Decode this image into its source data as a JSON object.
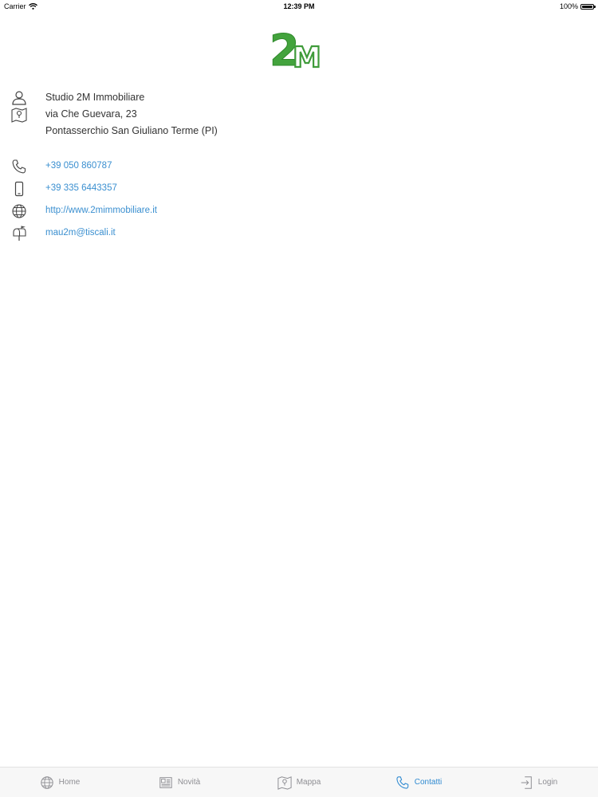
{
  "status": {
    "carrier": "Carrier",
    "time": "12:39 PM",
    "battery": "100%",
    "battery_level": 1.0
  },
  "logo": {
    "text": "2M",
    "color_primary": "#3f9b3a",
    "color_outline": "#2f8a2b"
  },
  "contact": {
    "name": "Studio 2M Immobiliare",
    "address_line1": "via Che Guevara, 23",
    "address_line2": "Pontasserchio San Giuliano Terme (PI)",
    "phone": "+39 050 860787",
    "mobile": "+39 335 6443357",
    "website": "http://www.2mimmobiliare.it",
    "email": "mau2m@tiscali.it"
  },
  "colors": {
    "link": "#3a8fd0",
    "tab_active": "#2f8ad1",
    "tab_inactive": "#8e8e93"
  },
  "tabbar": {
    "tabs": [
      {
        "label": "Home",
        "icon": "globe-icon",
        "active": false
      },
      {
        "label": "Novità",
        "icon": "newspaper-icon",
        "active": false
      },
      {
        "label": "Mappa",
        "icon": "map-icon",
        "active": false
      },
      {
        "label": "Contatti",
        "icon": "phone-icon",
        "active": true
      },
      {
        "label": "Login",
        "icon": "login-icon",
        "active": false
      }
    ]
  }
}
